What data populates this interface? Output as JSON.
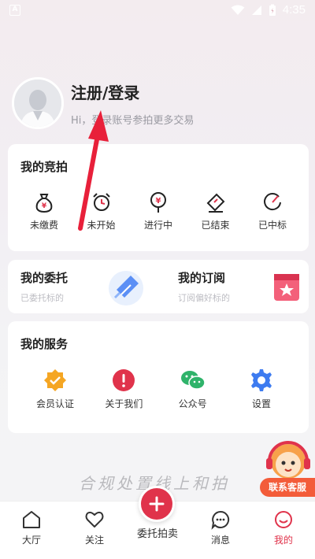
{
  "status_bar": {
    "time": "4:35",
    "app_icon_letter": "A"
  },
  "profile": {
    "title": "注册/登录",
    "subtitle": "Hi，登录账号参拍更多交易"
  },
  "my_bidding": {
    "title": "我的竞拍",
    "items": [
      {
        "label": "未缴费",
        "icon": "money-bag-icon"
      },
      {
        "label": "未开始",
        "icon": "alarm-clock-icon"
      },
      {
        "label": "进行中",
        "icon": "yuan-pin-icon"
      },
      {
        "label": "已结束",
        "icon": "ticket-icon"
      },
      {
        "label": "已中标",
        "icon": "gauge-icon"
      }
    ]
  },
  "entrust": {
    "title": "我的委托",
    "subtitle": "已委托标的"
  },
  "subscribe": {
    "title": "我的订阅",
    "subtitle": "订阅偏好标的"
  },
  "my_services": {
    "title": "我的服务",
    "items": [
      {
        "label": "会员认证",
        "icon": "verified-badge-icon",
        "color": "#f5a623"
      },
      {
        "label": "关于我们",
        "icon": "alert-icon",
        "color": "#e0334b"
      },
      {
        "label": "公众号",
        "icon": "wechat-icon",
        "color": "#2fb36a"
      },
      {
        "label": "设置",
        "icon": "gear-icon",
        "color": "#3d7bf0"
      }
    ]
  },
  "watermark": "合规处置线上和拍",
  "customer_service": "联系客服",
  "bottom_nav": {
    "items": [
      {
        "label": "大厅",
        "icon": "home-icon",
        "active": false
      },
      {
        "label": "关注",
        "icon": "heart-icon",
        "active": false
      },
      {
        "label": "委托拍卖",
        "icon": "plus-icon",
        "active": false
      },
      {
        "label": "消息",
        "icon": "message-icon",
        "active": false
      },
      {
        "label": "我的",
        "icon": "smile-icon",
        "active": true
      }
    ]
  },
  "colors": {
    "accent": "#e0334b",
    "active_nav": "#e0334b"
  }
}
